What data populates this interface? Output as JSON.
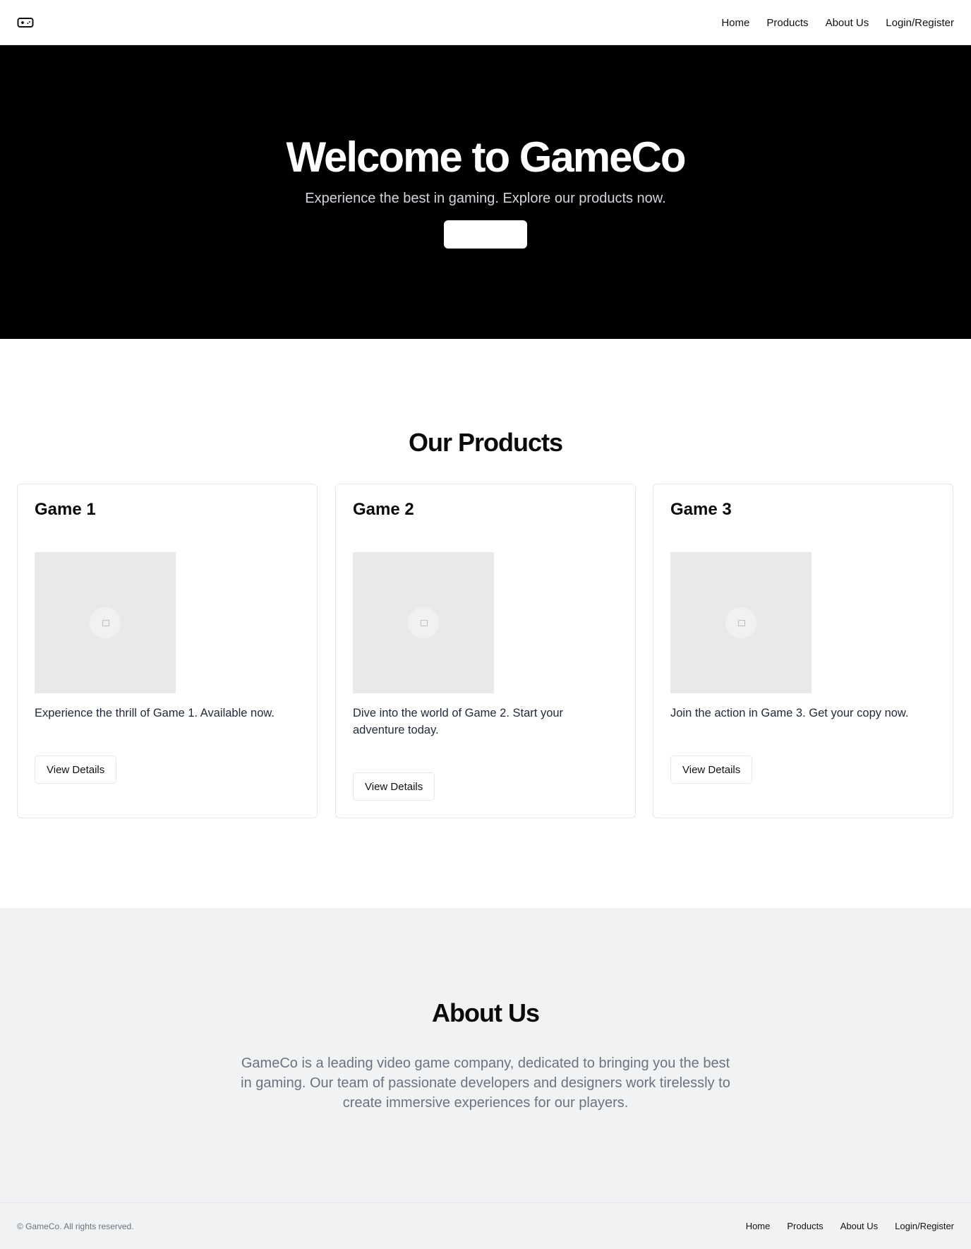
{
  "header": {
    "logo_icon": "gamepad-icon",
    "nav": [
      "Home",
      "Products",
      "About Us",
      "Login/Register"
    ]
  },
  "hero": {
    "title": "Welcome to GameCo",
    "subtitle": "Experience the best in gaming. Explore our products now.",
    "cta_label": ""
  },
  "products": {
    "title": "Our Products",
    "items": [
      {
        "name": "Game 1",
        "image_icon": "image-placeholder-icon",
        "description": "Experience the thrill of Game 1. Available now.",
        "button": "View Details"
      },
      {
        "name": "Game 2",
        "image_icon": "image-placeholder-icon",
        "description": "Dive into the world of Game 2. Start your adventure today.",
        "button": "View Details"
      },
      {
        "name": "Game 3",
        "image_icon": "image-placeholder-icon",
        "description": "Join the action in Game 3. Get your copy now.",
        "button": "View Details"
      }
    ]
  },
  "about": {
    "title": "About Us",
    "text": "GameCo is a leading video game company, dedicated to bringing you the best in gaming. Our team of passionate developers and designers work tirelessly to create immersive experiences for our players."
  },
  "footer": {
    "copyright": "© GameCo. All rights reserved.",
    "nav": [
      "Home",
      "Products",
      "About Us",
      "Login/Register"
    ]
  },
  "colors": {
    "hero_bg": "#000000",
    "about_bg": "#f1f2f4",
    "placeholder_bg": "#e9e9e9",
    "muted_text": "#6b7280"
  }
}
